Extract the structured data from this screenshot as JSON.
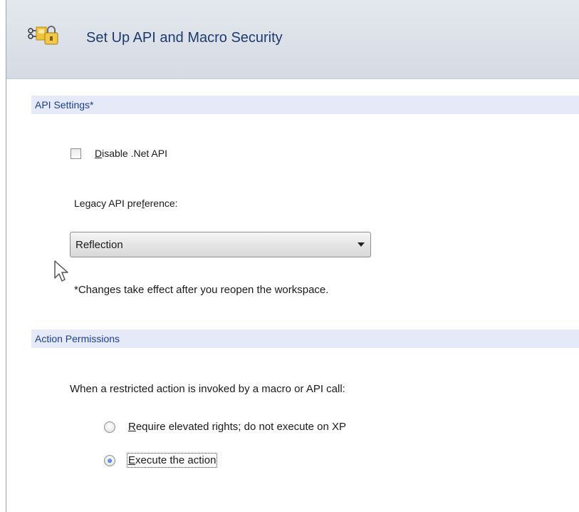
{
  "header": {
    "title": "Set Up API and Macro Security",
    "icon": "security-settings-icon"
  },
  "api_settings": {
    "section_title": "API Settings*",
    "disable_net_api": {
      "label_prefix": "D",
      "label_rest": "isable .Net API",
      "checked": false
    },
    "legacy_label_prefix": "Legacy API pre",
    "legacy_label_accel": "f",
    "legacy_label_rest": "erence:",
    "legacy_dropdown": {
      "selected": "Reflection"
    },
    "note": "*Changes take effect after you reopen the workspace."
  },
  "action_permissions": {
    "section_title": "Action Permissions",
    "prompt": "When a restricted action is invoked by a macro or API call:",
    "options": [
      {
        "label_prefix": "R",
        "label_rest": "equire elevated rights; do not execute on XP",
        "selected": false
      },
      {
        "label_prefix": "E",
        "label_rest": "xecute the action",
        "selected": true
      }
    ]
  },
  "colors": {
    "section_band": "#e6e9f7",
    "section_text": "#1b3f8b",
    "header_title": "#1e3a6e"
  }
}
